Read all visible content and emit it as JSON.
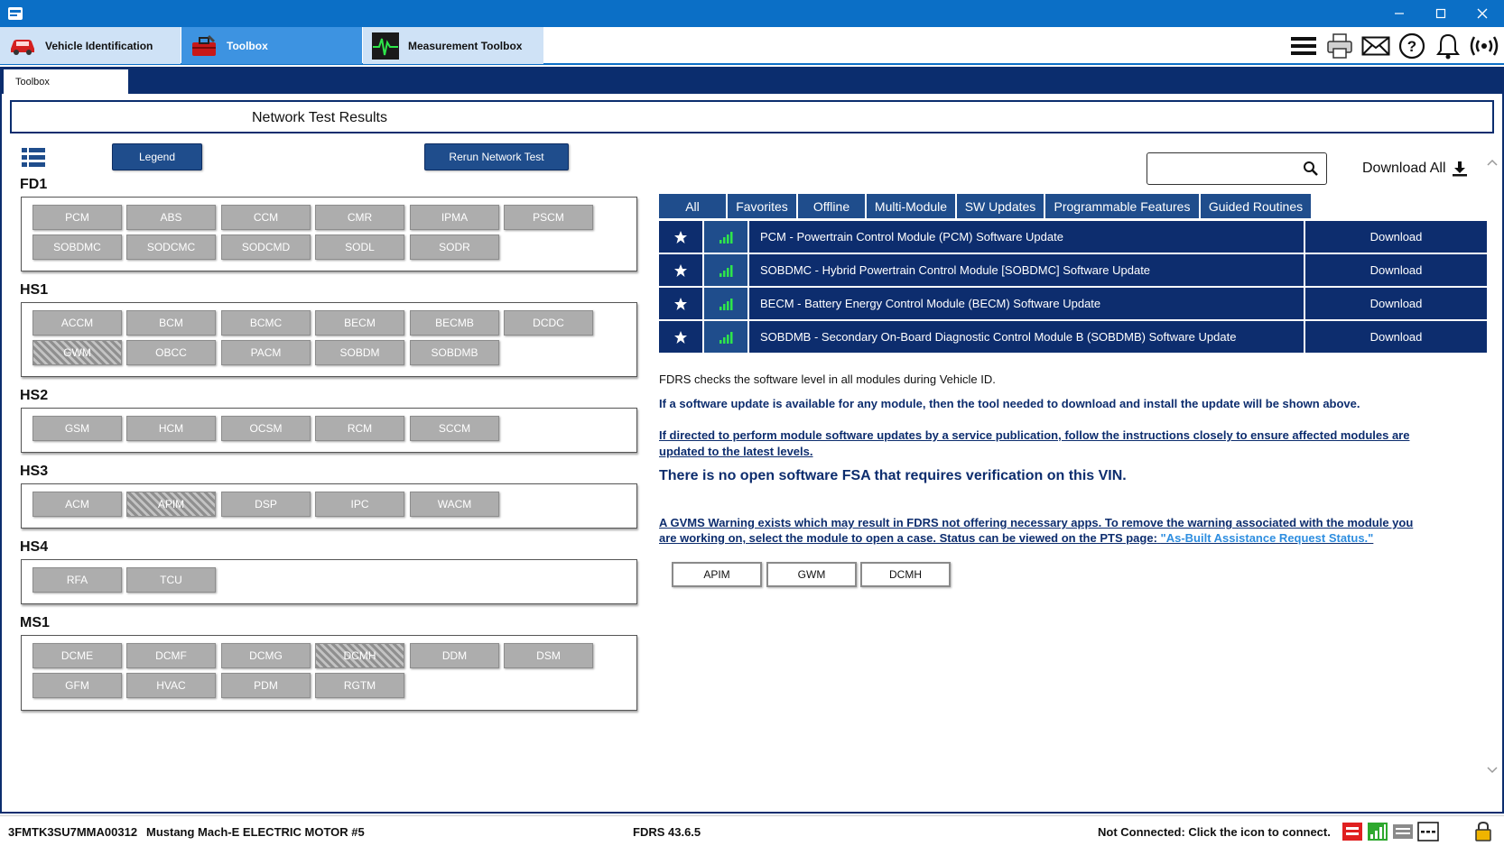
{
  "titlebar": {
    "app_icon": "fdrs-app-icon",
    "controls": [
      "minimize",
      "maximize",
      "close"
    ]
  },
  "main_tabs": [
    {
      "label": "Vehicle Identification",
      "icon": "car-icon"
    },
    {
      "label": "Toolbox",
      "icon": "toolbox-icon"
    },
    {
      "label": "Measurement Toolbox",
      "icon": "oscilloscope-icon"
    }
  ],
  "toolbar_icons": [
    "menu-icon",
    "printer-icon",
    "mail-icon",
    "help-icon",
    "bell-icon",
    "wireless-icon"
  ],
  "sub_tab": {
    "label": "Toolbox"
  },
  "header": {
    "title": "Network Test Results"
  },
  "buttons": {
    "legend": "Legend",
    "rerun": "Rerun Network Test"
  },
  "groups": [
    {
      "name": "FD1",
      "modules": [
        {
          "label": "PCM"
        },
        {
          "label": "ABS"
        },
        {
          "label": "CCM"
        },
        {
          "label": "CMR"
        },
        {
          "label": "IPMA"
        },
        {
          "label": "PSCM"
        },
        {
          "label": "SOBDMC"
        },
        {
          "label": "SODCMC"
        },
        {
          "label": "SODCMD"
        },
        {
          "label": "SODL"
        },
        {
          "label": "SODR"
        }
      ]
    },
    {
      "name": "HS1",
      "modules": [
        {
          "label": "ACCM"
        },
        {
          "label": "BCM"
        },
        {
          "label": "BCMC"
        },
        {
          "label": "BECM"
        },
        {
          "label": "BECMB"
        },
        {
          "label": "DCDC"
        },
        {
          "label": "GWM",
          "hatched": true
        },
        {
          "label": "OBCC"
        },
        {
          "label": "PACM"
        },
        {
          "label": "SOBDM"
        },
        {
          "label": "SOBDMB"
        }
      ]
    },
    {
      "name": "HS2",
      "modules": [
        {
          "label": "GSM"
        },
        {
          "label": "HCM"
        },
        {
          "label": "OCSM"
        },
        {
          "label": "RCM"
        },
        {
          "label": "SCCM"
        }
      ]
    },
    {
      "name": "HS3",
      "modules": [
        {
          "label": "ACM"
        },
        {
          "label": "APIM",
          "hatched": true
        },
        {
          "label": "DSP"
        },
        {
          "label": "IPC"
        },
        {
          "label": "WACM"
        }
      ]
    },
    {
      "name": "HS4",
      "modules": [
        {
          "label": "RFA"
        },
        {
          "label": "TCU"
        }
      ]
    },
    {
      "name": "MS1",
      "modules": [
        {
          "label": "DCME"
        },
        {
          "label": "DCMF"
        },
        {
          "label": "DCMG"
        },
        {
          "label": "DCMH",
          "hatched": true
        },
        {
          "label": "DDM"
        },
        {
          "label": "DSM"
        },
        {
          "label": "GFM"
        },
        {
          "label": "HVAC"
        },
        {
          "label": "PDM"
        },
        {
          "label": "RGTM"
        }
      ]
    }
  ],
  "search": {
    "value": "",
    "placeholder": ""
  },
  "download_all": "Download All",
  "filters": [
    "All",
    "Favorites",
    "Offline",
    "Multi-Module",
    "SW Updates",
    "Programmable Features",
    "Guided Routines"
  ],
  "updates": [
    {
      "desc": "PCM - Powertrain Control Module (PCM) Software Update",
      "action": "Download"
    },
    {
      "desc": "SOBDMC - Hybrid Powertrain Control Module [SOBDMC] Software Update",
      "action": "Download"
    },
    {
      "desc": "BECM - Battery Energy Control Module (BECM) Software Update",
      "action": "Download"
    },
    {
      "desc": "SOBDMB - Secondary On-Board Diagnostic Control Module B (SOBDMB) Software Update",
      "action": "Download"
    }
  ],
  "info": {
    "line1": "FDRS checks the software level in all modules during Vehicle ID.",
    "line2": "If a software update is available for any module, then the tool needed to download and install the update will be shown above.",
    "line3a": "If directed to perform module software updates by a service publication, follow the instructions closely to ensure affected modules are",
    "line3b": "updated to the latest levels.",
    "fsa": "There is no open software FSA that requires verification on this VIN.",
    "gvms_a": "A GVMS Warning exists which may result in FDRS not offering necessary apps. To remove the warning associated with the module you",
    "gvms_b": "are working on, select the module to open a case. Status can be viewed on the PTS page:",
    "gvms_link": "\"As-Built Assistance Request Status.\""
  },
  "gvms_modules": [
    "APIM",
    "GWM",
    "DCMH"
  ],
  "status": {
    "vin": "3FMTK3SU7MMA00312",
    "model": "Mustang Mach-E ELECTRIC MOTOR #5",
    "version": "FDRS 43.6.5",
    "connection": "Not Connected: Click the icon to connect."
  },
  "colors": {
    "titlebar": "#0b6fc6",
    "navy": "#0d2d6e",
    "button": "#1f4d8c",
    "module_gray": "#adadad",
    "link": "#2e8ee0"
  }
}
